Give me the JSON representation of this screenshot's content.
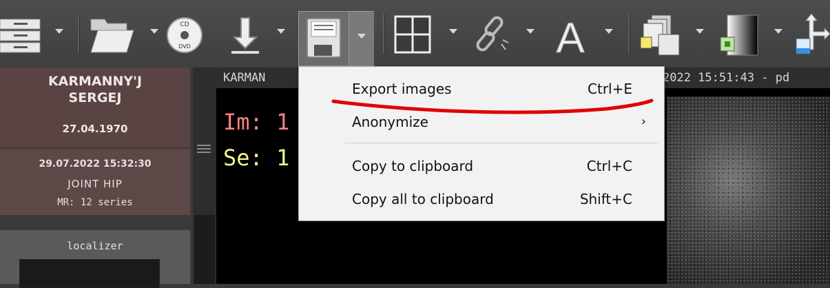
{
  "colors": {
    "accent_red": "#e00000",
    "patient_bg": "#5a4343",
    "overlay_red": "#ff8080",
    "overlay_yellow": "#f5f58a"
  },
  "toolbar": {
    "items": [
      {
        "name": "database-icon"
      },
      {
        "name": "open-folder-icon"
      },
      {
        "name": "cd-dvd-icon",
        "text_top": "CD",
        "text_bottom": "DVD"
      },
      {
        "name": "download-icon"
      },
      {
        "name": "save-floppy-icon"
      },
      {
        "name": "layout-grid-icon"
      },
      {
        "name": "link-icon"
      },
      {
        "name": "text-annotation-icon",
        "glyph": "A"
      },
      {
        "name": "series-stack-icon"
      },
      {
        "name": "window-level-icon"
      },
      {
        "name": "move-icon"
      }
    ]
  },
  "patient": {
    "name_line1": "KARMANNY'J",
    "name_line2": "SERGEJ",
    "dob": "27.04.1970"
  },
  "study": {
    "datetime": "29.07.2022 15:32:30",
    "description": "JOINT HIP",
    "modality_info": "MR: 12 series"
  },
  "series": {
    "label": "localizer"
  },
  "viewer": {
    "title_left": "KARMAN",
    "title_right": "2022 15:51:43 - pd",
    "overlay_im": "Im: 1",
    "overlay_se": "Se: 1"
  },
  "menu": {
    "items": [
      {
        "label": "Export images",
        "shortcut": "Ctrl+E"
      },
      {
        "label": "Anonymize",
        "arrow": "›"
      },
      {
        "label": "Copy to clipboard",
        "shortcut": "Ctrl+C"
      },
      {
        "label": "Copy all to clipboard",
        "shortcut": "Shift+C"
      }
    ]
  }
}
